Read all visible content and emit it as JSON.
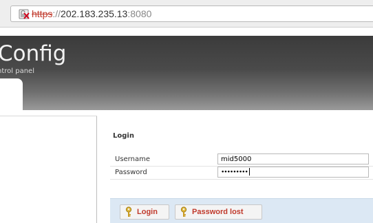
{
  "browser": {
    "url_scheme": "https",
    "url_separator": "://",
    "url_host": "202.183.235.13",
    "url_port": ":8080",
    "security_icon": "broken-lock-icon"
  },
  "header": {
    "title": "Config",
    "subtitle": "ntrol panel"
  },
  "login": {
    "heading": "Login",
    "username_label": "Username",
    "username_value": "mid5000",
    "password_label": "Password",
    "password_value": "•••••••••"
  },
  "buttons": {
    "login_label": "Login",
    "password_lost_label": "Password lost",
    "icon": "key-icon"
  },
  "colors": {
    "button_text": "#c0392b",
    "button_bar_bg": "#dce8f4",
    "header_dark": "#3b3b3b"
  }
}
